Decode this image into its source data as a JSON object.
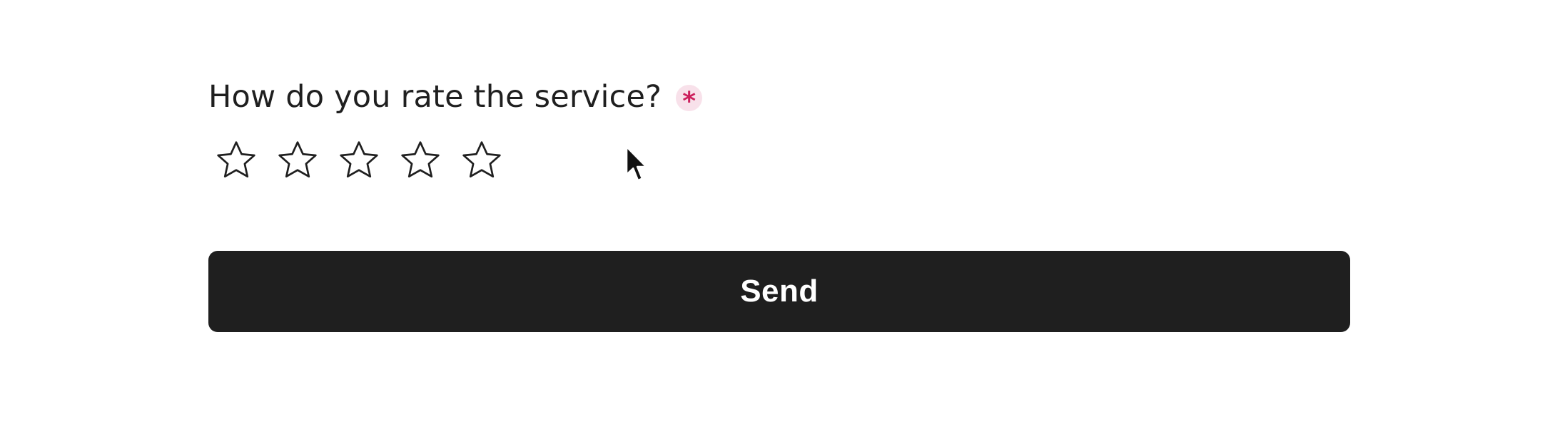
{
  "question": {
    "label": "How do you rate the service?",
    "required_mark": "*"
  },
  "rating": {
    "max_stars": 5,
    "selected": 0,
    "star_icon": "star-outline-icon"
  },
  "form": {
    "submit_label": "Send"
  },
  "colors": {
    "text": "#1f1f1f",
    "required_bg": "#f8e1ea",
    "required_fg": "#cc1f5c",
    "button_bg": "#1f1f1f",
    "button_fg": "#ffffff",
    "star_stroke": "#1f1f1f"
  }
}
